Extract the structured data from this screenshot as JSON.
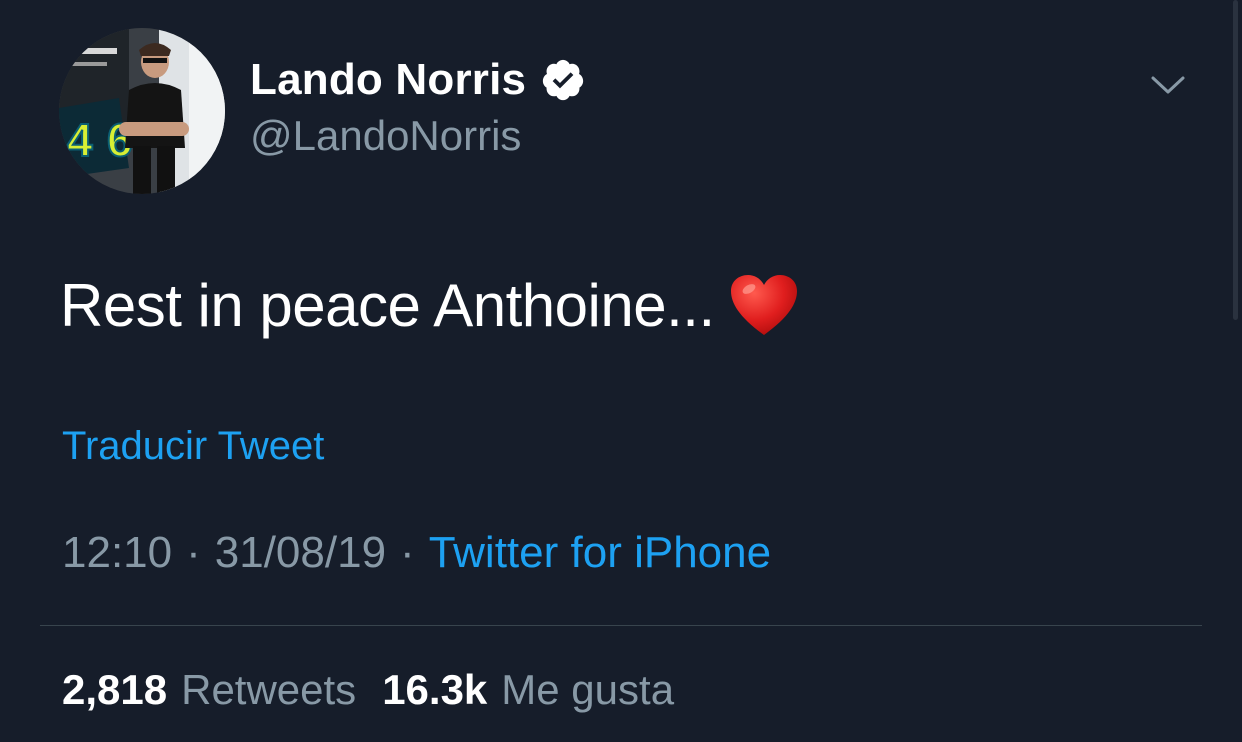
{
  "tweet": {
    "author": {
      "display_name": "Lando Norris",
      "handle": "@LandoNorris",
      "verified_icon": "verified-badge-icon",
      "avatar_badge_number": "4"
    },
    "text": "Rest in peace Anthoine...",
    "emoji": "heart-icon",
    "translate_label": "Traducir Tweet",
    "time": "12:10",
    "separator": "·",
    "date": "31/08/19",
    "source": "Twitter for iPhone",
    "stats": {
      "retweets_count": "2,818",
      "retweets_label": "Retweets",
      "likes_count": "16.3k",
      "likes_label": "Me gusta"
    },
    "menu_icon": "chevron-down-icon"
  },
  "colors": {
    "background": "#161d2a",
    "text_primary": "#ffffff",
    "text_secondary": "#8899a6",
    "link": "#1da1f2",
    "divider": "#38444d",
    "heart": "#e0245e"
  }
}
